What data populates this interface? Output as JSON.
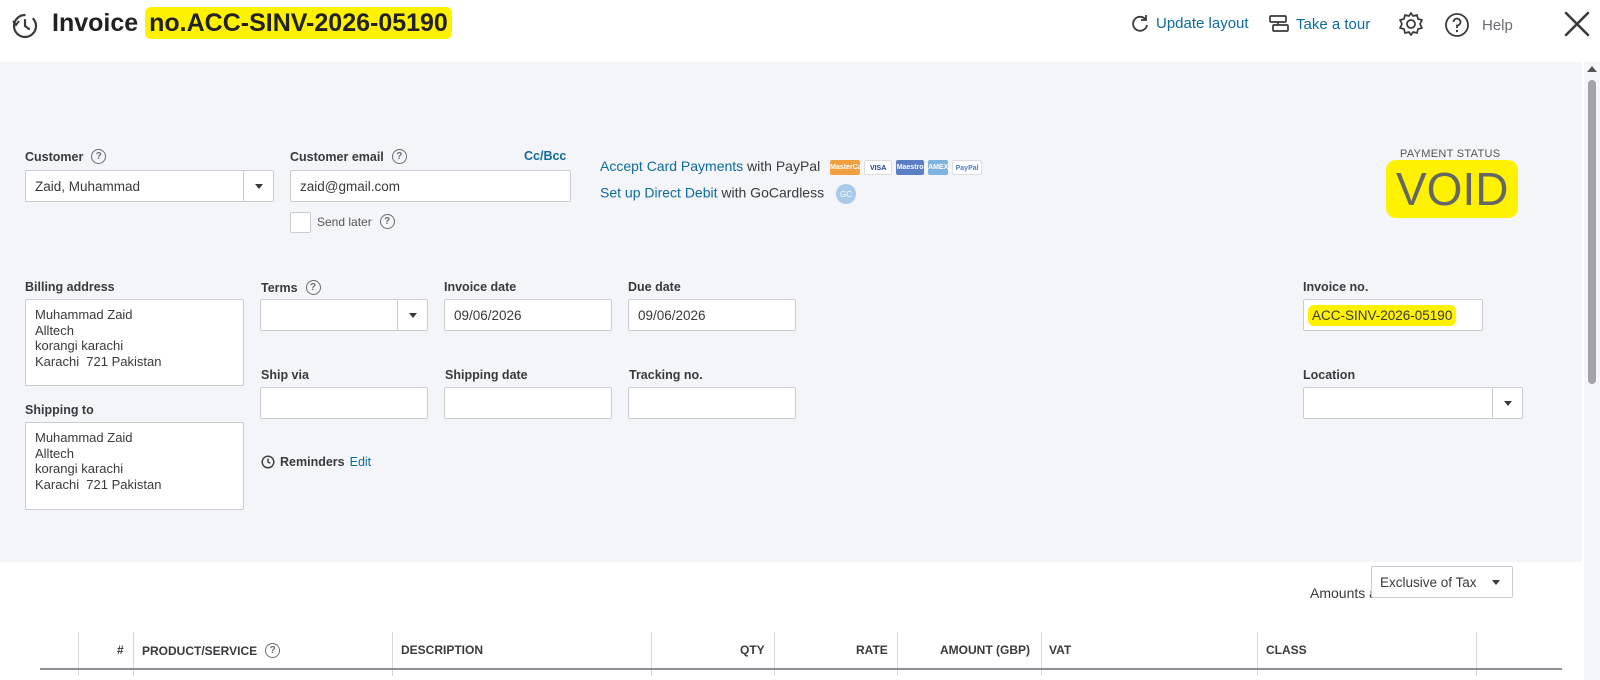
{
  "header": {
    "title_prefix": "Invoice",
    "title_number": "no.ACC-SINV-2026-05190",
    "update_layout": "Update layout",
    "take_tour": "Take a tour",
    "help": "Help"
  },
  "customer": {
    "label": "Customer",
    "value": "Zaid, Muhammad"
  },
  "customer_email": {
    "label": "Customer email",
    "value": "zaid@gmail.com",
    "cc_bcc": "Cc/Bcc",
    "send_later": "Send later"
  },
  "payments": {
    "paypal_link": "Accept Card Payments",
    "paypal_suffix": " with PayPal",
    "directdebit_link": "Set up Direct Debit",
    "directdebit_suffix": " with GoCardless",
    "gc_badge": "GC",
    "cards": [
      "MasterCard",
      "VISA",
      "Maestro",
      "AMEX",
      "PayPal"
    ]
  },
  "payment_status": {
    "label": "PAYMENT STATUS",
    "value": "VOID"
  },
  "billing": {
    "label": "Billing address",
    "lines": [
      "Muhammad Zaid",
      "Alltech",
      "korangi karachi",
      "Karachi  721 Pakistan"
    ]
  },
  "shipping": {
    "label": "Shipping to",
    "lines": [
      "Muhammad Zaid",
      "Alltech",
      "korangi karachi",
      "Karachi  721 Pakistan"
    ]
  },
  "terms": {
    "label": "Terms",
    "value": ""
  },
  "invoice_date": {
    "label": "Invoice date",
    "value": "09/06/2026"
  },
  "due_date": {
    "label": "Due date",
    "value": "09/06/2026"
  },
  "invoice_no": {
    "label": "Invoice no.",
    "value": "ACC-SINV-2026-05190"
  },
  "ship_via": {
    "label": "Ship via",
    "value": ""
  },
  "shipping_date": {
    "label": "Shipping date",
    "value": ""
  },
  "tracking_no": {
    "label": "Tracking no.",
    "value": ""
  },
  "location": {
    "label": "Location",
    "value": ""
  },
  "reminders": {
    "label": "Reminders",
    "edit": "Edit"
  },
  "amounts": {
    "label": "Amounts are",
    "value": "Exclusive of Tax"
  },
  "table": {
    "headers": {
      "num": "#",
      "product": "PRODUCT/SERVICE",
      "description": "DESCRIPTION",
      "qty": "QTY",
      "rate": "RATE",
      "amount": "AMOUNT (GBP)",
      "vat": "VAT",
      "class": "CLASS"
    }
  },
  "colors": {
    "link": "#0d6b9e",
    "highlight": "#fff200",
    "form_bg": "#f4f5f8"
  }
}
